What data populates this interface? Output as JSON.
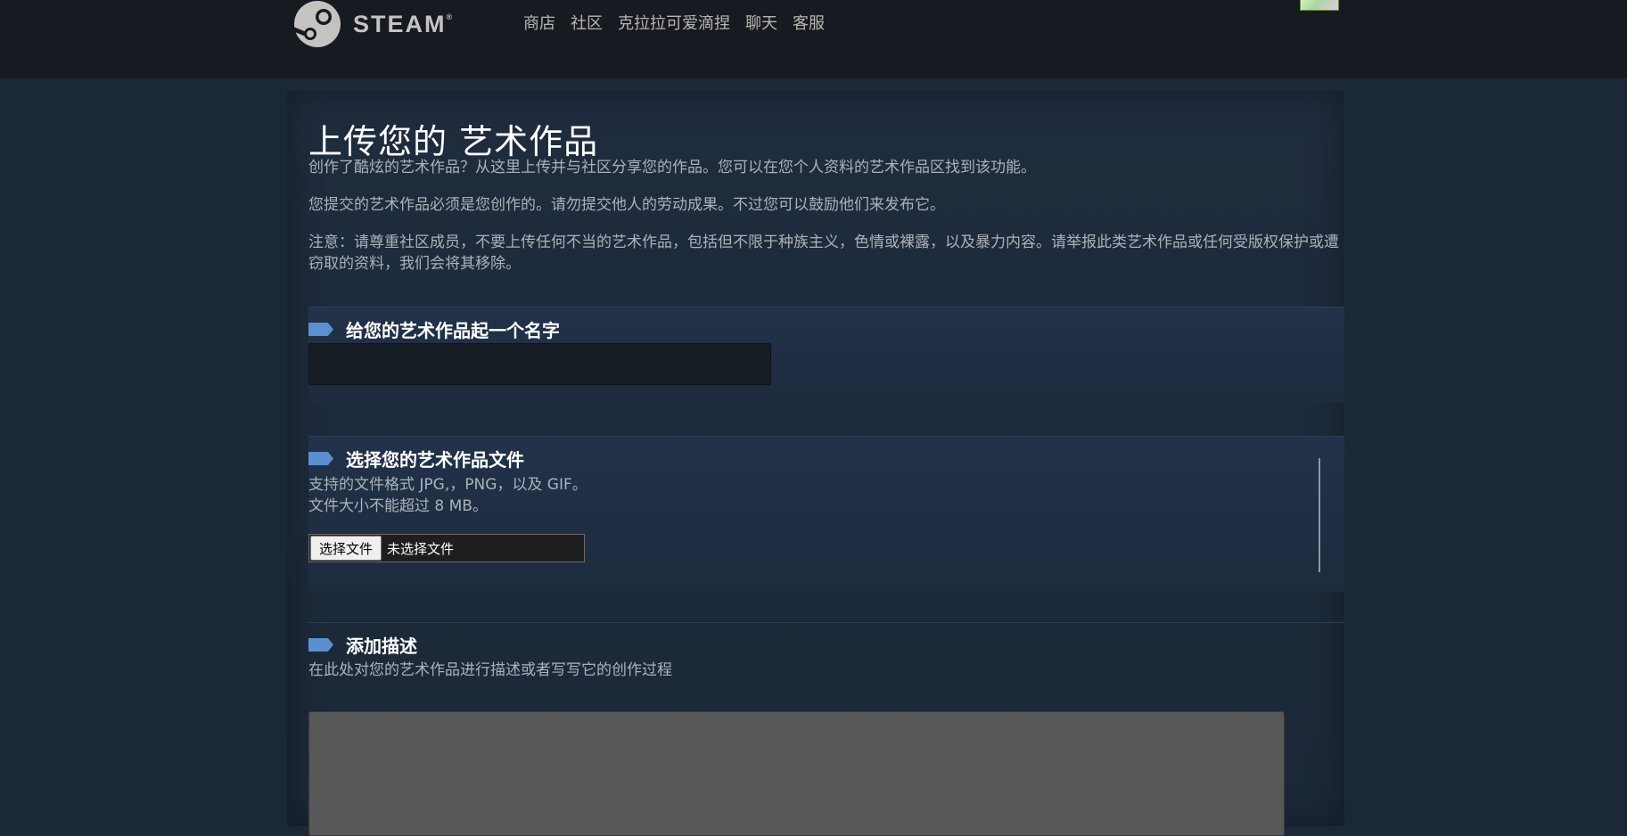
{
  "header": {
    "logo_text": "STEAM",
    "logo_mark": "®",
    "nav": [
      "商店",
      "社区",
      "克拉拉可爱滴捏",
      "聊天",
      "客服"
    ]
  },
  "page": {
    "title": "上传您的 艺术作品",
    "intro": "创作了酷炫的艺术作品？从这里上传并与社区分享您的作品。您可以在您个人资料的艺术作品区找到该功能。",
    "rule": "您提交的艺术作品必须是您创作的。请勿提交他人的劳动成果。不过您可以鼓励他们来发布它。",
    "notice": "注意：请尊重社区成员，不要上传任何不当的艺术作品，包括但不限于种族主义，色情或裸露，以及暴力内容。请举报此类艺术作品或任何受版权保护或遭窃取的资料，我们会将其移除。"
  },
  "sections": {
    "name": {
      "title": "给您的艺术作品起一个名字",
      "value": ""
    },
    "file": {
      "title": "选择您的艺术作品文件",
      "formats": "支持的文件格式 JPG,，PNG，以及 GIF。",
      "size": "文件大小不能超过 8 MB。",
      "button": "选择文件",
      "status": "未选择文件"
    },
    "description": {
      "title": "添加描述",
      "hint": "在此处对您的艺术作品进行描述或者写写它的创作过程",
      "value": ""
    }
  },
  "colors": {
    "background": "#1b2838",
    "topbar": "#171a21",
    "accent": "#5c8fce",
    "textarea": "#575757"
  }
}
